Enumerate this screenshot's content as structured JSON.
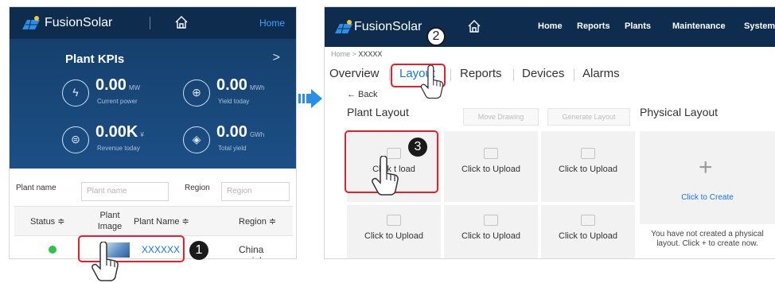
{
  "brand": {
    "name": "FusionSolar"
  },
  "left_panel": {
    "home_label": "Home",
    "kpis_title": "Plant KPIs",
    "kpis": [
      {
        "value": "0.00",
        "unit": "MW",
        "label": "Current power",
        "icon": "power-icon"
      },
      {
        "value": "0.00",
        "unit": "MWh",
        "label": "Yield today",
        "icon": "yield-today-icon"
      },
      {
        "value": "0.00K",
        "unit": "¥",
        "label": "Revenue today",
        "icon": "revenue-icon"
      },
      {
        "value": "0.00",
        "unit": "GWh",
        "label": "Total yield",
        "icon": "total-yield-icon"
      }
    ],
    "filters": {
      "plant_name_label": "Plant name",
      "plant_name_placeholder": "Plant name",
      "region_label": "Region",
      "region_placeholder": "Region"
    },
    "table": {
      "headers": {
        "status": "Status ≑",
        "plant_image": "Plant Image",
        "plant_name": "Plant Name ≑",
        "region": "Region ≑"
      },
      "rows": [
        {
          "plant_name": "XXXXXX",
          "region": "China mainl..."
        }
      ]
    }
  },
  "right_panel": {
    "nav": [
      "Home",
      "Reports",
      "Plants",
      "Maintenance",
      "System"
    ],
    "breadcrumb": {
      "home": "Home",
      "sep": ">",
      "current": "XXXXX"
    },
    "tabs": [
      "Overview",
      "Layout",
      "Reports",
      "Devices",
      "Alarms"
    ],
    "back_label": "← Back",
    "plant_layout_title": "Plant Layout",
    "move_drawing": "Move Drawing",
    "generate_layout": "Generate Layout",
    "physical_layout_title": "Physical Layout",
    "upload_label": "Click to Upload",
    "upload_partial_label": "Click t     load",
    "create_label": "Click to Create",
    "physical_note": "You have not created a physical layout. Click + to create now."
  },
  "steps": [
    "1",
    "2",
    "3"
  ],
  "colors": {
    "header_bg": "#0d2c4e",
    "kpi_bg": "#1c4f86",
    "accent_blue": "#1a73d9",
    "callout_red": "#e5202a",
    "status_green": "#2ec44a"
  }
}
